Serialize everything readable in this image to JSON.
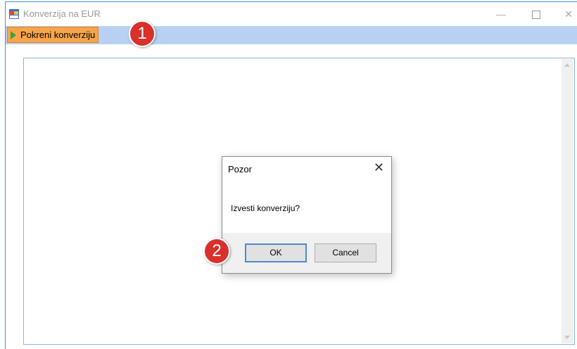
{
  "window": {
    "title": "Konverzija na EUR",
    "controls": {
      "minimize": "—",
      "close": "✕"
    }
  },
  "toolbar": {
    "run_label": "Pokreni konverziju"
  },
  "dialog": {
    "title": "Pozor",
    "close_glyph": "✕",
    "message": "Izvesti konverziju?",
    "ok_label": "OK",
    "cancel_label": "Cancel"
  },
  "annotations": {
    "step1": "1",
    "step2": "2"
  },
  "colors": {
    "toolbar_bg": "#b8d1f3",
    "run_button_bg": "#f8a54a",
    "badge_red": "#d9302b",
    "ok_focus_border": "#4a8ad4"
  },
  "icons": {
    "app": "app-window-icon",
    "run": "play-triangle-icon"
  }
}
